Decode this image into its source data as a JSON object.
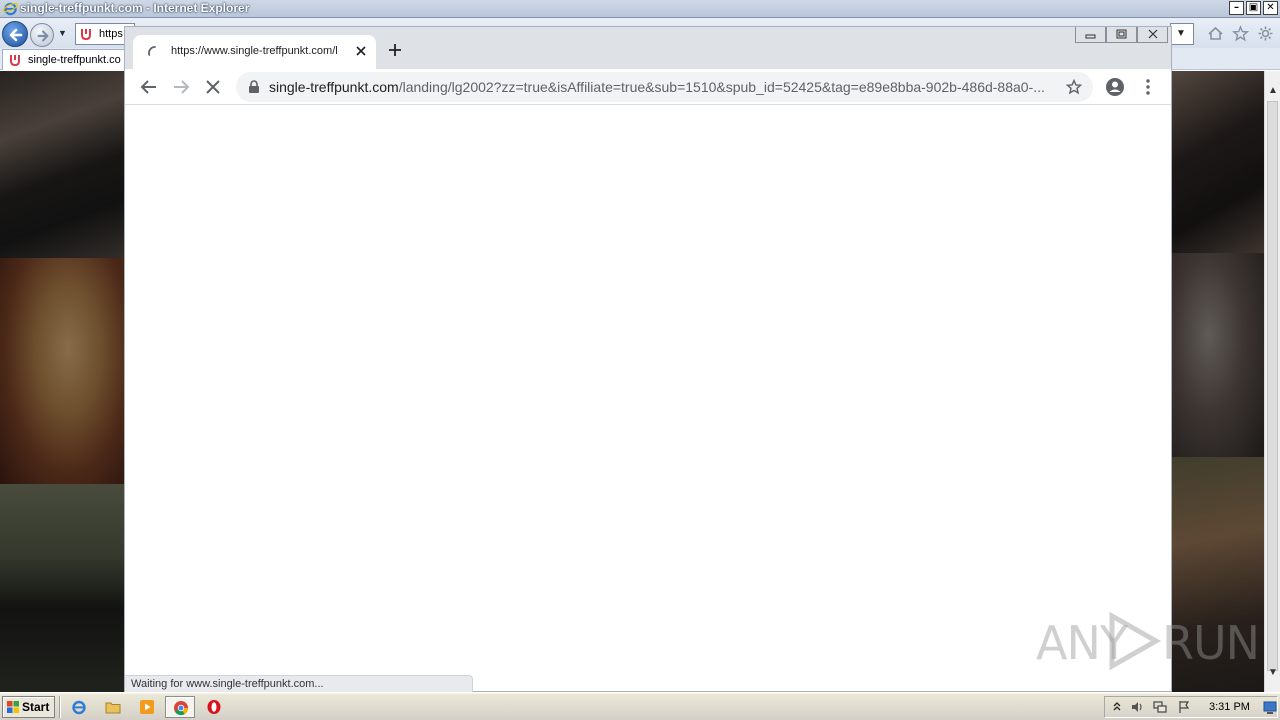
{
  "ie": {
    "window_title": "single-treffpunkt.com - Internet Explorer",
    "address_text": "https",
    "tab_title": "single-treffpunkt.co",
    "winbtn_min": "–",
    "winbtn_max": "▣",
    "winbtn_close": "✕",
    "addr_dropdown": "▼",
    "scroll_up": "▲",
    "scroll_down": "▼"
  },
  "chrome": {
    "tab_title": "https://www.single-treffpunkt.com/l",
    "url_domain": "single-treffpunkt.com",
    "url_path": "/landing/lg2002?zz=true&isAffiliate=true&sub=1510&spub_id=52425&tag=e89e8bba-902b-486d-88a0-...",
    "status_text": "Waiting for www.single-treffpunkt.com..."
  },
  "watermark": {
    "left": "ANY",
    "right": "RUN"
  },
  "taskbar": {
    "start_label": "Start",
    "clock": "3:31 PM"
  },
  "icons": {
    "ie_back": "back-arrow-icon",
    "ie_forward": "forward-arrow-icon",
    "chrome_reload_stop": "stop-x-icon",
    "chrome_star": "star-icon",
    "chrome_profile": "account-circle-icon",
    "chrome_menu": "kebab-menu-icon"
  },
  "colors": {
    "chrome_tabstrip": "#dee1e6",
    "omnibox": "#f1f3f4",
    "ie_chrome": "#d7e0ec",
    "taskbar": "#d4d0c8"
  }
}
